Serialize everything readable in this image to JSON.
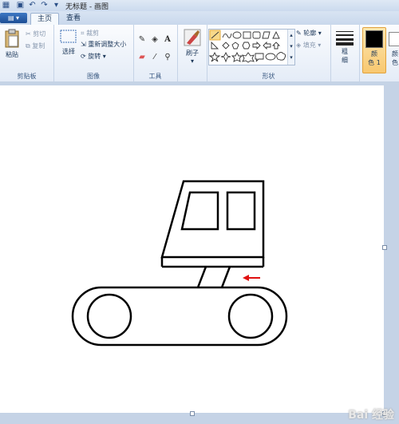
{
  "title": "无标题 - 画图",
  "tabs": [
    {
      "label": "主页"
    },
    {
      "label": "查看"
    }
  ],
  "ribbon": {
    "clipboard": {
      "label": "剪贴板",
      "paste": "粘贴",
      "cut": "剪切",
      "copy": "复制"
    },
    "image": {
      "label": "图像",
      "select": "选择",
      "crop": "裁剪",
      "resize": "重新调整大小",
      "rotate": "旋转"
    },
    "tools": {
      "label": "工具"
    },
    "brushes": {
      "label": "刷子"
    },
    "shapes": {
      "label": "形状",
      "outline": "轮廓",
      "fill": "填充"
    },
    "size": {
      "label_top": "粗",
      "label_bottom": "细"
    },
    "color1": {
      "label_top": "颜",
      "label_bottom": "色 1"
    },
    "color2": {
      "label_top": "颜",
      "label_bottom": "色"
    }
  },
  "watermark": "Bai 经验",
  "colors": {
    "accent": "#1c4d94",
    "drawing": "#000000",
    "arrow": "#e01010",
    "color1": "#000000",
    "color2": "#ffffff"
  },
  "icons": [
    "paint-app-icon",
    "save-icon",
    "undo-icon",
    "redo-icon",
    "pencil-icon",
    "fill-icon",
    "text-icon",
    "eraser-icon",
    "color-picker-icon",
    "magnifier-icon",
    "brush-icon"
  ]
}
